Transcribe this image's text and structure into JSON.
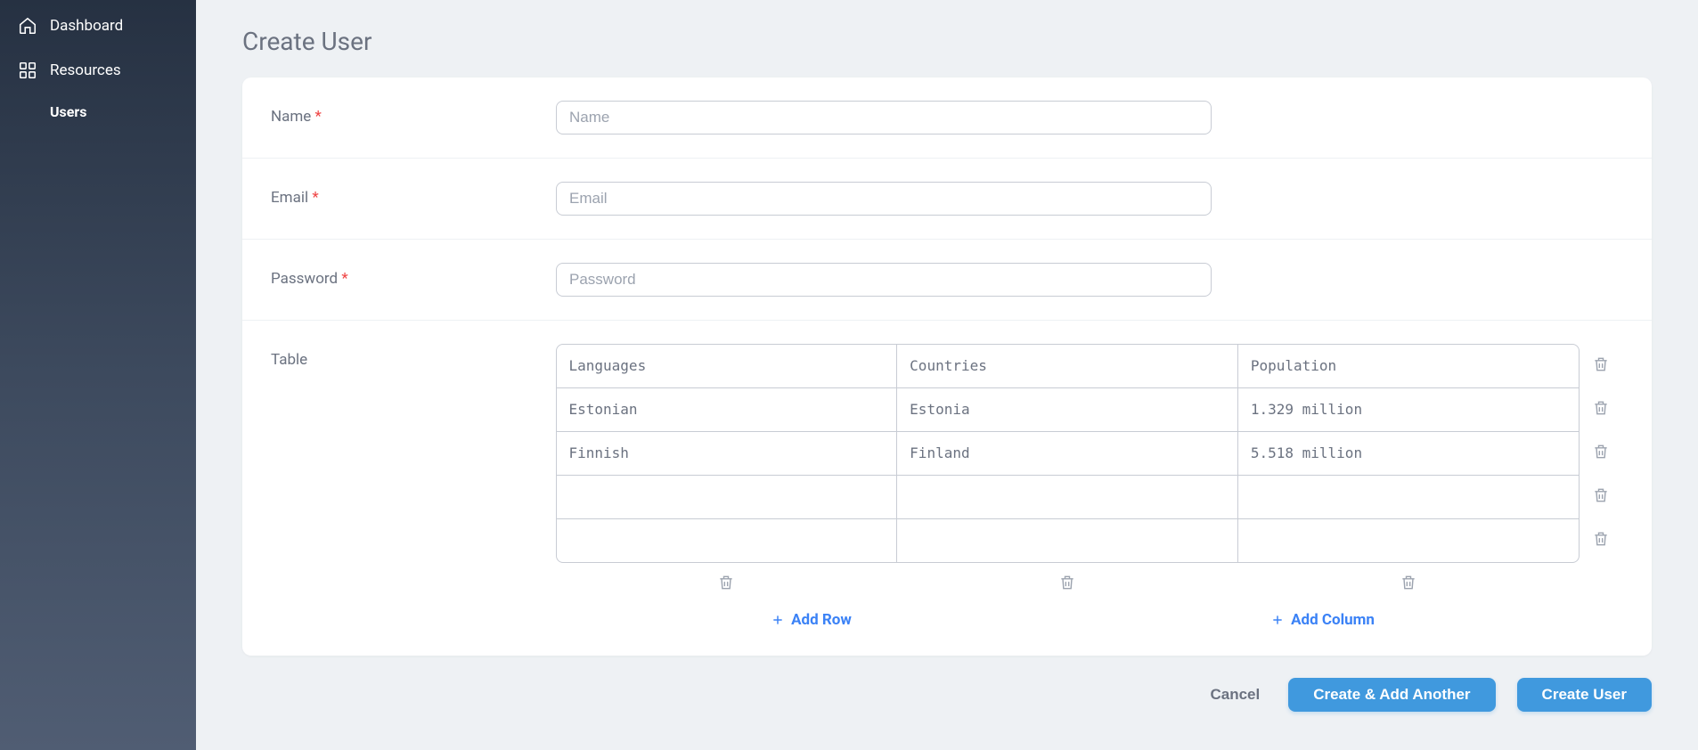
{
  "sidebar": {
    "items": [
      {
        "label": "Dashboard"
      },
      {
        "label": "Resources"
      }
    ],
    "subitems": [
      {
        "label": "Users"
      }
    ]
  },
  "page": {
    "title": "Create User"
  },
  "form": {
    "name": {
      "label": "Name",
      "placeholder": "Name",
      "required": "*"
    },
    "email": {
      "label": "Email",
      "placeholder": "Email",
      "required": "*"
    },
    "password": {
      "label": "Password",
      "placeholder": "Password",
      "required": "*"
    },
    "table": {
      "label": "Table",
      "headers": [
        "Languages",
        "Countries",
        "Population"
      ],
      "rows": [
        [
          "Estonian",
          "Estonia",
          "1.329 million"
        ],
        [
          "Finnish",
          "Finland",
          "5.518 million"
        ],
        [
          "",
          "",
          ""
        ],
        [
          "",
          "",
          ""
        ]
      ],
      "add_row_label": "Add Row",
      "add_column_label": "Add Column"
    }
  },
  "actions": {
    "cancel": "Cancel",
    "create_another": "Create & Add Another",
    "create": "Create User"
  }
}
